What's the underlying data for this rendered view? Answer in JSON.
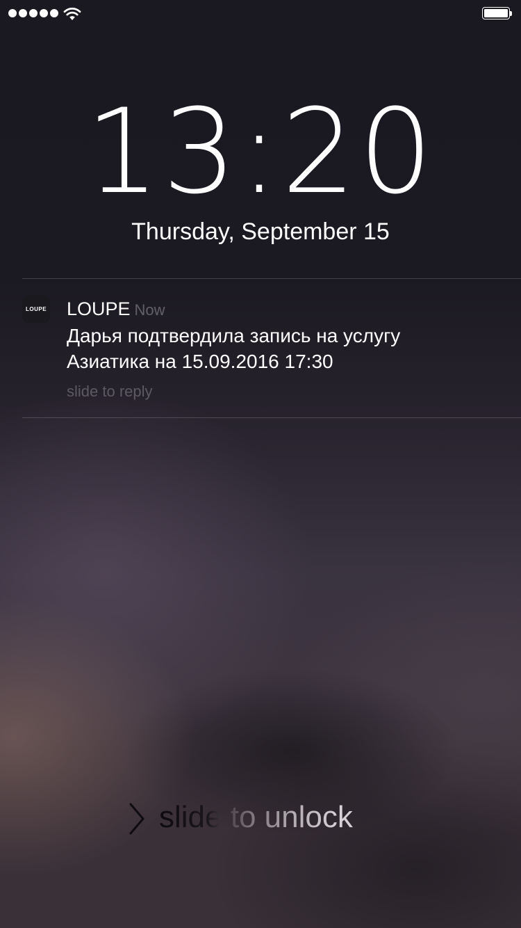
{
  "lock_screen": {
    "time": "13:20",
    "date": "Thursday, September 15"
  },
  "notification": {
    "app_icon_label": "LOUPE",
    "app_name": "LOUPE",
    "time": "Now",
    "message_line1": "Дарья подтвердила запись на услугу",
    "message_line2": "Азиатика на 15.09.2016 17:30",
    "reply_hint": "slide to reply"
  },
  "unlock": {
    "label": "slide to unlock"
  },
  "status_bar": {
    "signal_bars": 5,
    "wifi_icon": "wifi-icon",
    "battery_icon": "battery-icon",
    "battery_level_percent": 100
  },
  "icons": {
    "chevron": "chevron-right-icon"
  }
}
